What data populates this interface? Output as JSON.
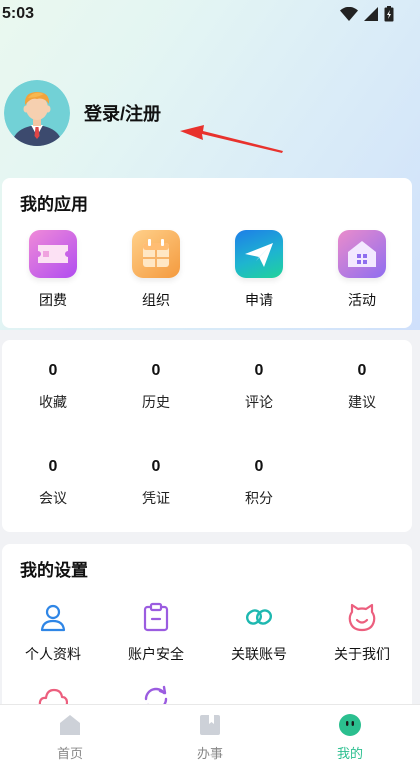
{
  "status_bar": {
    "time": "5:03"
  },
  "profile": {
    "login_label": "登录/注册"
  },
  "apps_section": {
    "title": "我的应用",
    "items": [
      {
        "label": "团费",
        "icon": "ticket-icon"
      },
      {
        "label": "组织",
        "icon": "calendar-icon"
      },
      {
        "label": "申请",
        "icon": "paper-plane-icon"
      },
      {
        "label": "活动",
        "icon": "house-icon"
      }
    ]
  },
  "stats": [
    {
      "value": "0",
      "label": "收藏"
    },
    {
      "value": "0",
      "label": "历史"
    },
    {
      "value": "0",
      "label": "评论"
    },
    {
      "value": "0",
      "label": "建议"
    },
    {
      "value": "0",
      "label": "会议"
    },
    {
      "value": "0",
      "label": "凭证"
    },
    {
      "value": "0",
      "label": "积分"
    }
  ],
  "settings_section": {
    "title": "我的设置",
    "items": [
      {
        "label": "个人资料",
        "icon": "user-icon"
      },
      {
        "label": "账户安全",
        "icon": "clipboard-icon"
      },
      {
        "label": "关联账号",
        "icon": "link-icon"
      },
      {
        "label": "关于我们",
        "icon": "face-icon"
      },
      {
        "label": "",
        "icon": "cloud-icon"
      },
      {
        "label": "",
        "icon": "refresh-icon"
      }
    ]
  },
  "tabbar": {
    "tabs": [
      {
        "label": "首页",
        "icon": "home-icon",
        "active": false
      },
      {
        "label": "办事",
        "icon": "bookmark-icon",
        "active": false
      },
      {
        "label": "我的",
        "icon": "profile-icon",
        "active": true
      }
    ]
  },
  "colors": {
    "accent": "#2bbf8f",
    "settings_icon_blue": "#2f86e6",
    "settings_icon_purple": "#9b5ce0",
    "settings_icon_teal": "#1eb8b0",
    "settings_icon_pink": "#ec5f7e",
    "arrow_red": "#e8322d"
  }
}
